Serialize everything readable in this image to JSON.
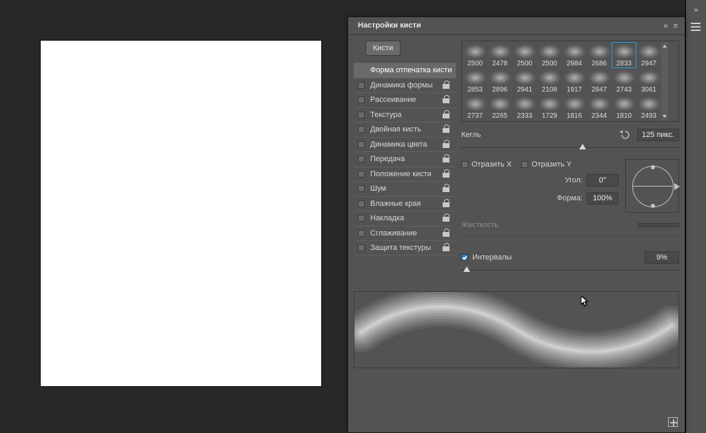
{
  "panel": {
    "title": "Настройки кисти",
    "brushes_btn": "Кисти",
    "options": [
      {
        "label": "Форма отпечатка кисти",
        "checkbox": false,
        "lock": false,
        "selected": true
      },
      {
        "label": "Динамика формы",
        "checkbox": true,
        "lock": true
      },
      {
        "label": "Рассеивание",
        "checkbox": true,
        "lock": true
      },
      {
        "label": "Текстура",
        "checkbox": true,
        "lock": true
      },
      {
        "label": "Двойная кисть",
        "checkbox": true,
        "lock": true
      },
      {
        "label": "Динамика цвета",
        "checkbox": true,
        "lock": true
      },
      {
        "label": "Передача",
        "checkbox": true,
        "lock": true
      },
      {
        "label": "Положение кисти",
        "checkbox": true,
        "lock": true
      },
      {
        "label": "Шум",
        "checkbox": true,
        "lock": true
      },
      {
        "label": "Влажные края",
        "checkbox": true,
        "lock": true
      },
      {
        "label": "Накладка",
        "checkbox": true,
        "lock": true
      },
      {
        "label": "Сглаживание",
        "checkbox": true,
        "lock": true
      },
      {
        "label": "Защита текстуры",
        "checkbox": true,
        "lock": true
      }
    ],
    "presets_row1": [
      2500,
      2478,
      2500,
      2500,
      2984,
      2686,
      2833,
      2947
    ],
    "presets_row2": [
      2853,
      2896,
      2941,
      2108,
      1917,
      2847,
      2743,
      3061
    ],
    "presets_row3": [
      2737,
      2265,
      2333,
      1729,
      1816,
      2344,
      1810,
      2493
    ],
    "selected_preset": 2833,
    "size": {
      "label": "Кегль",
      "value": "125 пикс."
    },
    "flip_x": "Отразить X",
    "flip_y": "Отразить Y",
    "angle_label": "Угол:",
    "angle_value": "0°",
    "shape_label": "Форма:",
    "shape_value": "100%",
    "hardness_label": "Жесткость",
    "hardness_value": "",
    "intervals_label": "Интервалы",
    "intervals_value": "9%"
  }
}
